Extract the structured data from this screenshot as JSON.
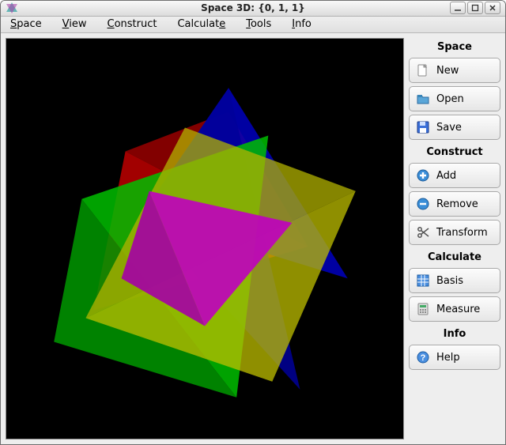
{
  "window": {
    "title": "Space 3D: {0, 1, 1}"
  },
  "menubar": {
    "items": [
      {
        "label": "Space",
        "accel_index": 0
      },
      {
        "label": "View",
        "accel_index": 0
      },
      {
        "label": "Construct",
        "accel_index": 0
      },
      {
        "label": "Calculate",
        "accel_index": 8
      },
      {
        "label": "Tools",
        "accel_index": 0
      },
      {
        "label": "Info",
        "accel_index": 0
      }
    ]
  },
  "sidebar": {
    "groups": [
      {
        "header": "Space",
        "buttons": [
          {
            "name": "new-button",
            "icon": "file-icon",
            "label": "New"
          },
          {
            "name": "open-button",
            "icon": "folder-icon",
            "label": "Open"
          },
          {
            "name": "save-button",
            "icon": "floppy-icon",
            "label": "Save"
          }
        ]
      },
      {
        "header": "Construct",
        "buttons": [
          {
            "name": "add-button",
            "icon": "plus-icon",
            "label": "Add"
          },
          {
            "name": "remove-button",
            "icon": "minus-icon",
            "label": "Remove"
          },
          {
            "name": "transform-button",
            "icon": "scissors-icon",
            "label": "Transform"
          }
        ]
      },
      {
        "header": "Calculate",
        "buttons": [
          {
            "name": "basis-button",
            "icon": "grid-icon",
            "label": "Basis"
          },
          {
            "name": "measure-button",
            "icon": "calc-icon",
            "label": "Measure"
          }
        ]
      },
      {
        "header": "Info",
        "buttons": [
          {
            "name": "help-button",
            "icon": "help-icon",
            "label": "Help"
          }
        ]
      }
    ]
  },
  "viewport": {
    "background": "#000000",
    "shapes": [
      {
        "name": "tetrahedron",
        "color": "#ff0000"
      },
      {
        "name": "tetrahedron",
        "color": "#00ff00"
      },
      {
        "name": "tetrahedron",
        "color": "#0000ff"
      },
      {
        "name": "tetrahedron",
        "color": "#ffff00"
      },
      {
        "name": "tetrahedron",
        "color": "#ff00ff"
      }
    ]
  }
}
